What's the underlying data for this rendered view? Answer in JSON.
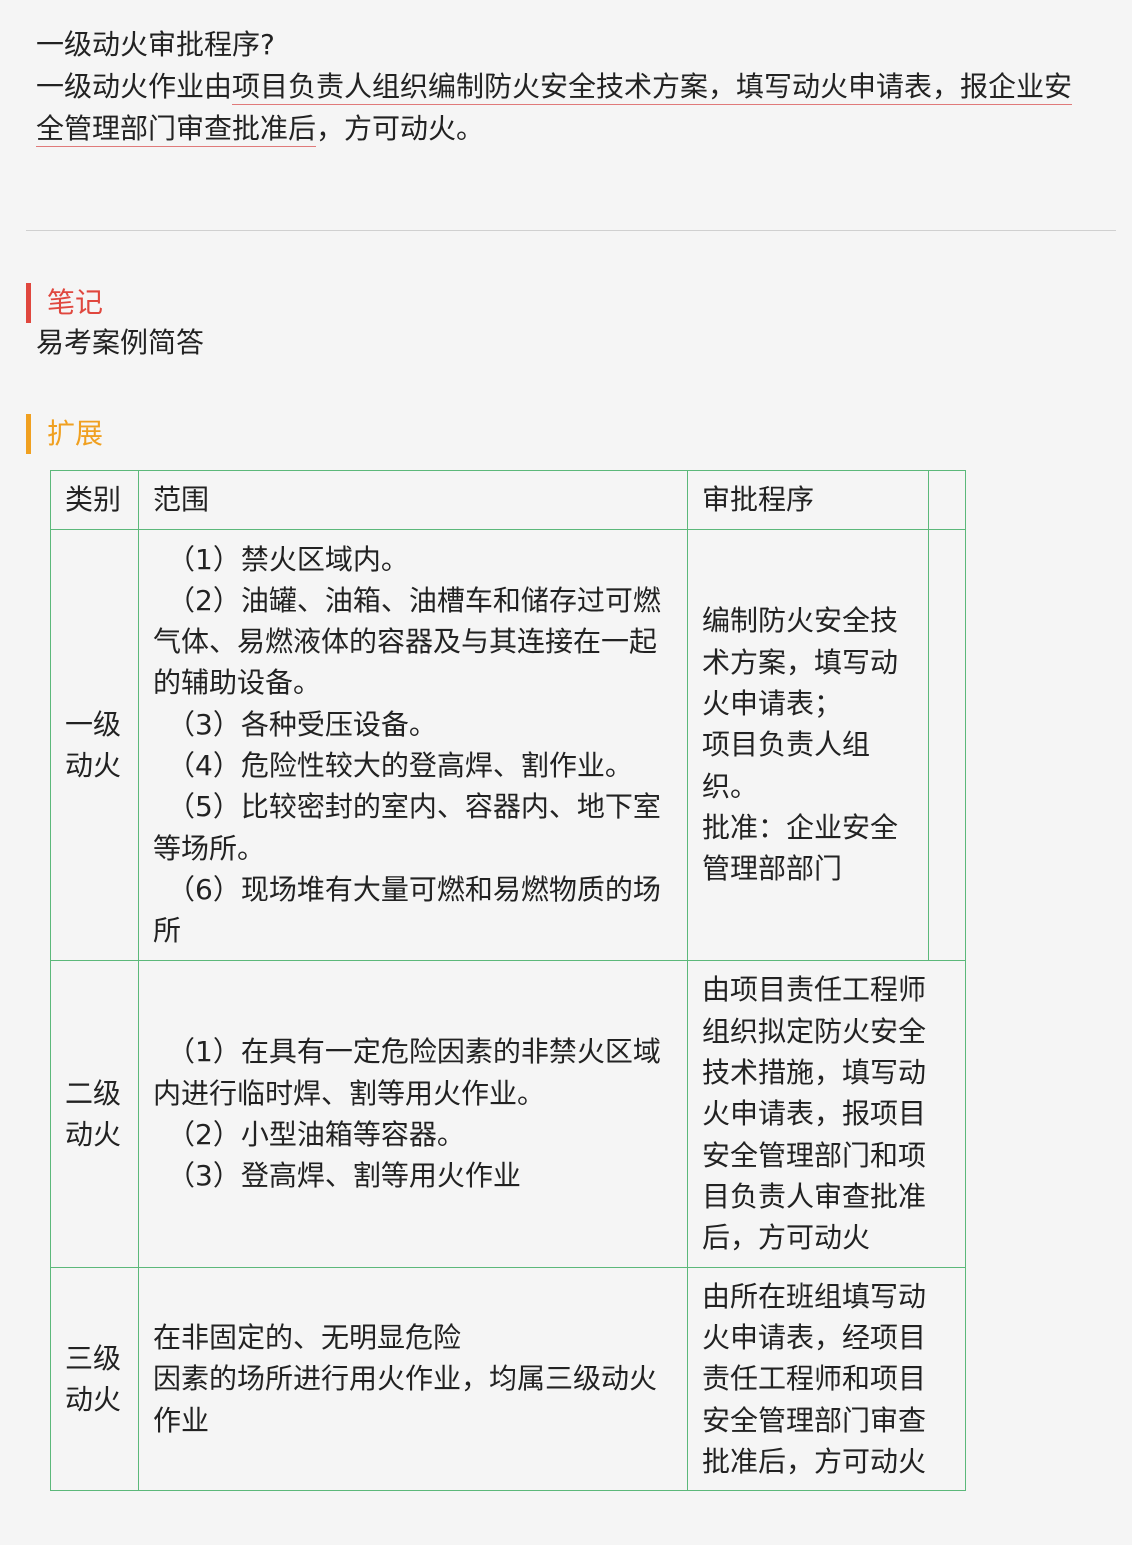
{
  "question": {
    "title": "一级动火审批程序?",
    "answer_part1": "一级动火作业由",
    "answer_underlined_1": "项目负责人组织编制防火安全技术方案，填写动火申请表，报企业安",
    "answer_underlined_2": "全管理部门审查批准后",
    "answer_part2": "，方可动火。"
  },
  "note": {
    "heading": "笔记",
    "body": "易考案例简答"
  },
  "extension": {
    "heading": "扩展",
    "table": {
      "headers": [
        "类别",
        "范围",
        "审批程序",
        ""
      ],
      "rows": [
        {
          "category_line1": "一级",
          "category_line2": "动火",
          "scope": [
            "（1）禁火区域内。",
            "（2）油罐、油箱、油槽车和储存过可燃",
            "气体、易燃液体的容器及与其连接在一起",
            "的辅助设备。",
            "（3）各种受压设备。",
            "（4）危险性较大的登高焊、割作业。",
            "（5）比较密封的室内、容器内、地下室",
            "等场所。",
            "（6）现场堆有大量可燃和易燃物质的场",
            "所"
          ],
          "approval": [
            "编制防火安全技",
            "术方案，填写动",
            "火申请表；",
            "项目负责人组",
            "织。",
            "批准：企业安全",
            "管理部部门"
          ]
        },
        {
          "category_line1": "二级",
          "category_line2": "动火",
          "scope": [
            "（1）在具有一定危险因素的非禁火区域",
            "内进行临时焊、割等用火作业。",
            "（2）小型油箱等容器。",
            "（3）登高焊、割等用火作业"
          ],
          "approval": [
            "由项目责任工程师",
            "组织拟定防火安全",
            "技术措施，填写动",
            "火申请表，报项目",
            "安全管理部门和项",
            "目负责人审查批准",
            "后，方可动火"
          ]
        },
        {
          "category_line1": "三级",
          "category_line2": "动火",
          "scope": [
            "在非固定的、无明显危险",
            "因素的场所进行用火作业，均属三级动火",
            "作业"
          ],
          "approval": [
            "由所在班组填写动",
            "火申请表，经项目",
            "责任工程师和项目",
            "安全管理部门审查",
            "批准后，方可动火"
          ]
        }
      ]
    }
  },
  "colors": {
    "note_accent": "#e0473e",
    "extension_accent": "#f0a020",
    "table_border": "#5cb87a",
    "underline": "#e07a7a"
  }
}
